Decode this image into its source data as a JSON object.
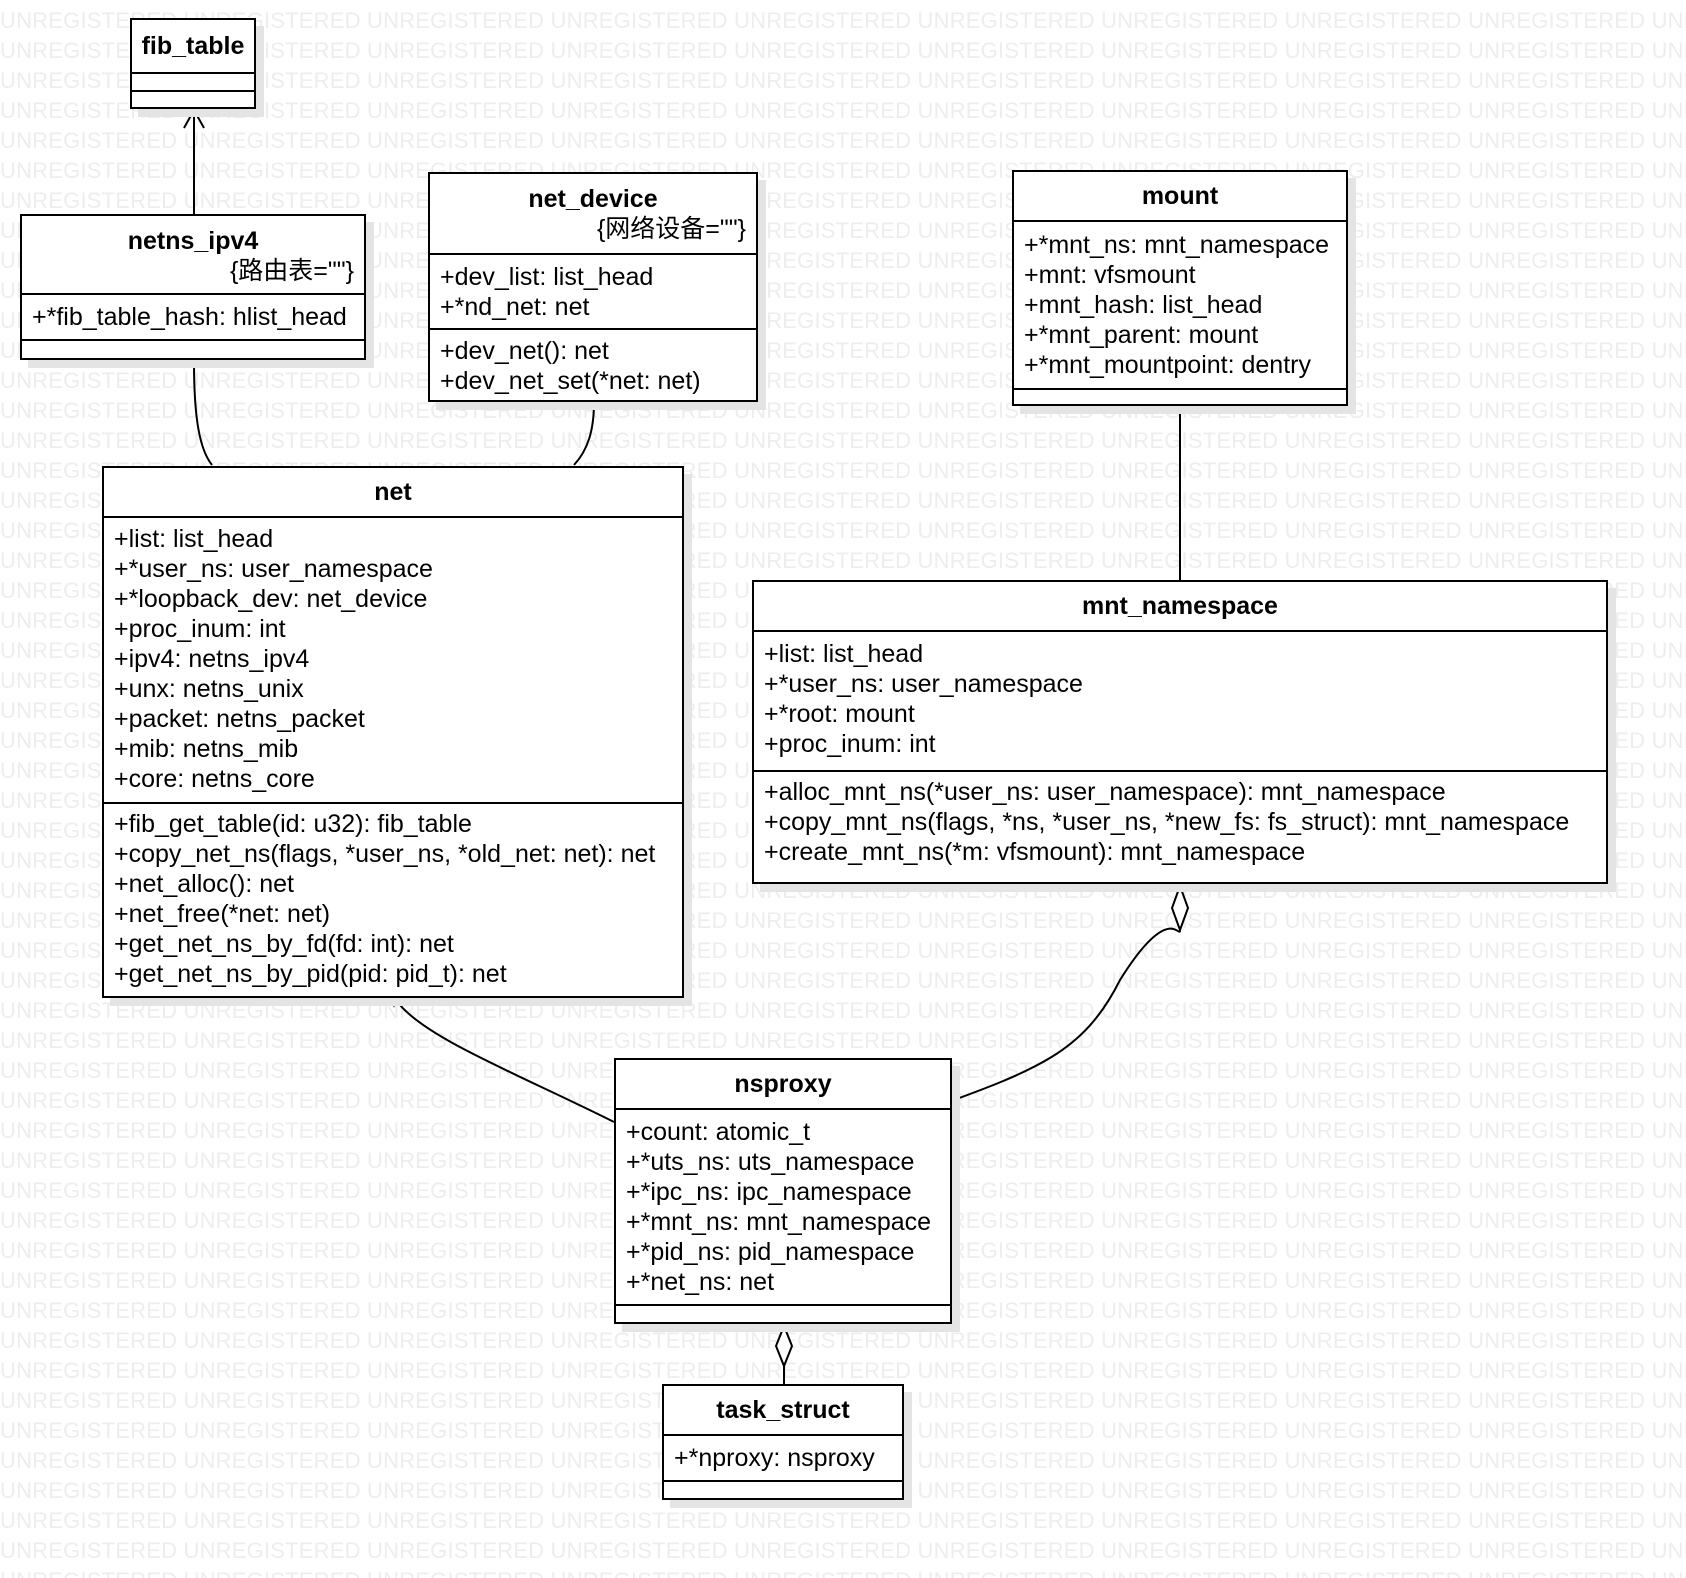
{
  "watermark": {
    "text": "UNREGISTERED"
  },
  "classes": {
    "fib_table": {
      "name": "fib_table",
      "attributes": [],
      "methods": []
    },
    "netns_ipv4": {
      "name": "netns_ipv4",
      "stereotype": "{路由表=\"\"}",
      "attributes": [
        "+*fib_table_hash: hlist_head"
      ],
      "methods": []
    },
    "net_device": {
      "name": "net_device",
      "stereotype": "{网络设备=\"\"}",
      "attributes": [
        "+dev_list: list_head",
        "+*nd_net: net"
      ],
      "methods": [
        "+dev_net(): net",
        "+dev_net_set(*net: net)"
      ]
    },
    "mount": {
      "name": "mount",
      "attributes": [
        "+*mnt_ns: mnt_namespace",
        "+mnt: vfsmount",
        "+mnt_hash: list_head",
        "+*mnt_parent: mount",
        "+*mnt_mountpoint: dentry"
      ],
      "methods": []
    },
    "net": {
      "name": "net",
      "attributes": [
        "+list: list_head",
        "+*user_ns: user_namespace",
        "+*loopback_dev: net_device",
        "+proc_inum: int",
        "+ipv4: netns_ipv4",
        "+unx: netns_unix",
        "+packet: netns_packet",
        "+mib: netns_mib",
        "+core: netns_core"
      ],
      "methods": [
        "+fib_get_table(id: u32): fib_table",
        "+copy_net_ns(flags, *user_ns, *old_net: net): net",
        "+net_alloc(): net",
        "+net_free(*net: net)",
        "+get_net_ns_by_fd(fd: int): net",
        "+get_net_ns_by_pid(pid: pid_t): net"
      ]
    },
    "mnt_namespace": {
      "name": "mnt_namespace",
      "attributes": [
        "+list: list_head",
        "+*user_ns: user_namespace",
        "+*root: mount",
        "+proc_inum: int"
      ],
      "methods": [
        "+alloc_mnt_ns(*user_ns: user_namespace): mnt_namespace",
        "+copy_mnt_ns(flags, *ns, *user_ns, *new_fs: fs_struct): mnt_namespace",
        "+create_mnt_ns(*m: vfsmount): mnt_namespace"
      ]
    },
    "nsproxy": {
      "name": "nsproxy",
      "attributes": [
        "+count: atomic_t",
        "+*uts_ns: uts_namespace",
        "+*ipc_ns: ipc_namespace",
        "+*mnt_ns: mnt_namespace",
        "+*pid_ns: pid_namespace",
        "+*net_ns: net"
      ],
      "methods": []
    },
    "task_struct": {
      "name": "task_struct",
      "attributes": [
        "+*nproxy: nsproxy"
      ],
      "methods": []
    }
  },
  "relations": [
    {
      "from": "netns_ipv4",
      "to": "fib_table",
      "kind": "directed-association"
    },
    {
      "from": "netns_ipv4",
      "to": "net",
      "kind": "association"
    },
    {
      "from": "net_device",
      "to": "net",
      "kind": "association"
    },
    {
      "from": "mount",
      "to": "mnt_namespace",
      "kind": "association"
    },
    {
      "from": "nsproxy",
      "to": "net",
      "kind": "aggregation"
    },
    {
      "from": "nsproxy",
      "to": "mnt_namespace",
      "kind": "aggregation"
    },
    {
      "from": "task_struct",
      "to": "nsproxy",
      "kind": "aggregation"
    }
  ]
}
